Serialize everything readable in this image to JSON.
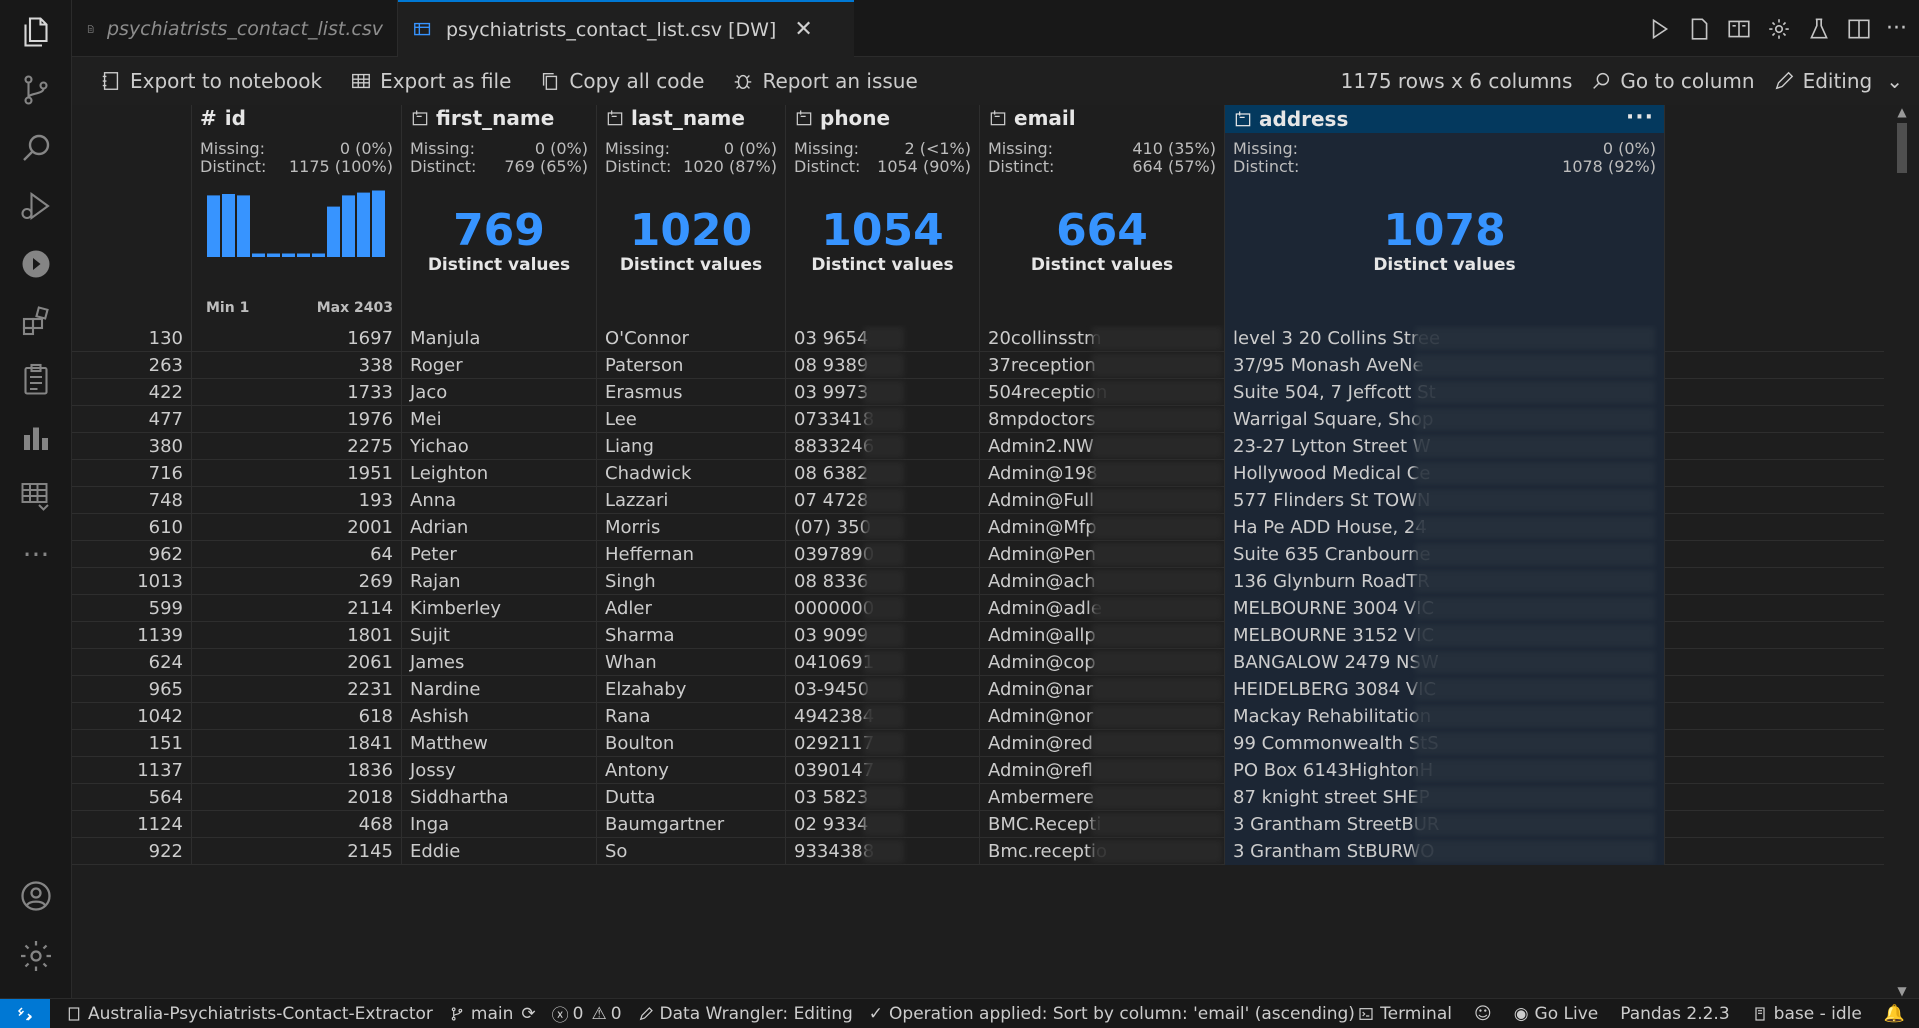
{
  "tabs": [
    {
      "label": "psychiatrists_contact_list.csv"
    },
    {
      "label": "psychiatrists_contact_list.csv [DW]"
    }
  ],
  "toolbar": {
    "export_notebook": "Export to notebook",
    "export_file": "Export as file",
    "copy_code": "Copy all code",
    "report_issue": "Report an issue",
    "row_count": "1175 rows x 6 columns",
    "go_to_column": "Go to column",
    "mode": "Editing"
  },
  "columns": [
    {
      "name": "id",
      "type_icon": "hash-icon",
      "missing": "0 (0%)",
      "distinct": "1175 (100%)",
      "hist_min": "Min 1",
      "hist_max": "Max 2403"
    },
    {
      "name": "first_name",
      "type_icon": "text-type-icon",
      "missing": "0 (0%)",
      "distinct": "769 (65%)",
      "big": "769",
      "sub": "Distinct values"
    },
    {
      "name": "last_name",
      "type_icon": "text-type-icon",
      "missing": "0 (0%)",
      "distinct": "1020 (87%)",
      "big": "1020",
      "sub": "Distinct values"
    },
    {
      "name": "phone",
      "type_icon": "text-type-icon",
      "missing": "2 (<1%)",
      "distinct": "1054 (90%)",
      "big": "1054",
      "sub": "Distinct values"
    },
    {
      "name": "email",
      "type_icon": "text-type-icon",
      "missing": "410 (35%)",
      "distinct": "664 (57%)",
      "big": "664",
      "sub": "Distinct values"
    },
    {
      "name": "address",
      "type_icon": "text-type-icon",
      "missing": "0 (0%)",
      "distinct": "1078 (92%)",
      "big": "1078",
      "sub": "Distinct values"
    }
  ],
  "stat_labels": {
    "missing": "Missing:",
    "distinct": "Distinct:"
  },
  "id_histogram": [
    0.88,
    0.9,
    0.88,
    0.05,
    0.05,
    0.05,
    0.05,
    0.05,
    0.72,
    0.88,
    0.92,
    0.95
  ],
  "rows": [
    [
      "130",
      "1697",
      "Manjula",
      "O'Connor",
      "03 9654",
      "20collinsstm",
      "level 3 20 Collins Stree"
    ],
    [
      "263",
      "338",
      "Roger",
      "Paterson",
      "08 9389",
      "37reception",
      "37/95 Monash AveNe"
    ],
    [
      "422",
      "1733",
      "Jaco",
      "Erasmus",
      "03 9973",
      "504reception",
      "Suite 504, 7 Jeffcott St"
    ],
    [
      "477",
      "1976",
      "Mei",
      "Lee",
      "0733418",
      "8mpdoctors",
      "Warrigal Square, Shop"
    ],
    [
      "380",
      "2275",
      "Yichao",
      "Liang",
      "8833246",
      "Admin2.NW",
      "23-27 Lytton Street W"
    ],
    [
      "716",
      "1951",
      "Leighton",
      "Chadwick",
      "08 6382",
      "Admin@198",
      "Hollywood Medical Ce"
    ],
    [
      "748",
      "193",
      "Anna",
      "Lazzari",
      "07 4728",
      "Admin@Full",
      "577 Flinders St TOWN"
    ],
    [
      "610",
      "2001",
      "Adrian",
      "Morris",
      "(07) 350",
      "Admin@Mfp",
      "Ha Pe ADD House, 24"
    ],
    [
      "962",
      "64",
      "Peter",
      "Heffernan",
      "0397890",
      "Admin@Pen",
      "Suite 635 Cranbourne"
    ],
    [
      "1013",
      "269",
      "Rajan",
      "Singh",
      "08 8336",
      "Admin@ach",
      "136 Glynburn RoadTR"
    ],
    [
      "599",
      "2114",
      "Kimberley",
      "Adler",
      "0000000",
      "Admin@adle",
      "MELBOURNE 3004 VIC"
    ],
    [
      "1139",
      "1801",
      "Sujit",
      "Sharma",
      "03 9099",
      "Admin@allp",
      "MELBOURNE 3152 VIC"
    ],
    [
      "624",
      "2061",
      "James",
      "Whan",
      "0410691",
      "Admin@cop",
      "BANGALOW 2479 NSW"
    ],
    [
      "965",
      "2231",
      "Nardine",
      "Elzahaby",
      "03-9450",
      "Admin@nar",
      "HEIDELBERG 3084 VIC"
    ],
    [
      "1042",
      "618",
      "Ashish",
      "Rana",
      "4942384",
      "Admin@nor",
      "Mackay Rehabilitation"
    ],
    [
      "151",
      "1841",
      "Matthew",
      "Boulton",
      "0292117",
      "Admin@red",
      "99 Commonwealth StS"
    ],
    [
      "1137",
      "1836",
      "Jossy",
      "Antony",
      "0390147",
      "Admin@refl",
      "PO Box 6143HightonH"
    ],
    [
      "564",
      "2018",
      "Siddhartha",
      "Dutta",
      "03 5823",
      "Ambermere",
      "87 knight street SHEP"
    ],
    [
      "1124",
      "468",
      "Inga",
      "Baumgartner",
      "02 9334",
      "BMC.Recepti",
      "3 Grantham StreetBUR"
    ],
    [
      "922",
      "2145",
      "Eddie",
      "So",
      "9334388",
      "Bmc.receptio",
      "3 Grantham StBURWO"
    ]
  ],
  "status": {
    "project": "Australia-Psychiatrists-Contact-Extractor",
    "branch": "main",
    "errors": "0",
    "warnings": "0",
    "wrangler": "Data Wrangler: Editing",
    "operation": "Operation applied: Sort by column: 'email' (ascending)",
    "terminal": "Terminal",
    "golive": "Go Live",
    "pandas": "Pandas 2.2.3",
    "kernel": "base - idle"
  },
  "colors": {
    "accent": "#3794ff",
    "selected_header": "#04395e",
    "remote": "#0078d4"
  }
}
